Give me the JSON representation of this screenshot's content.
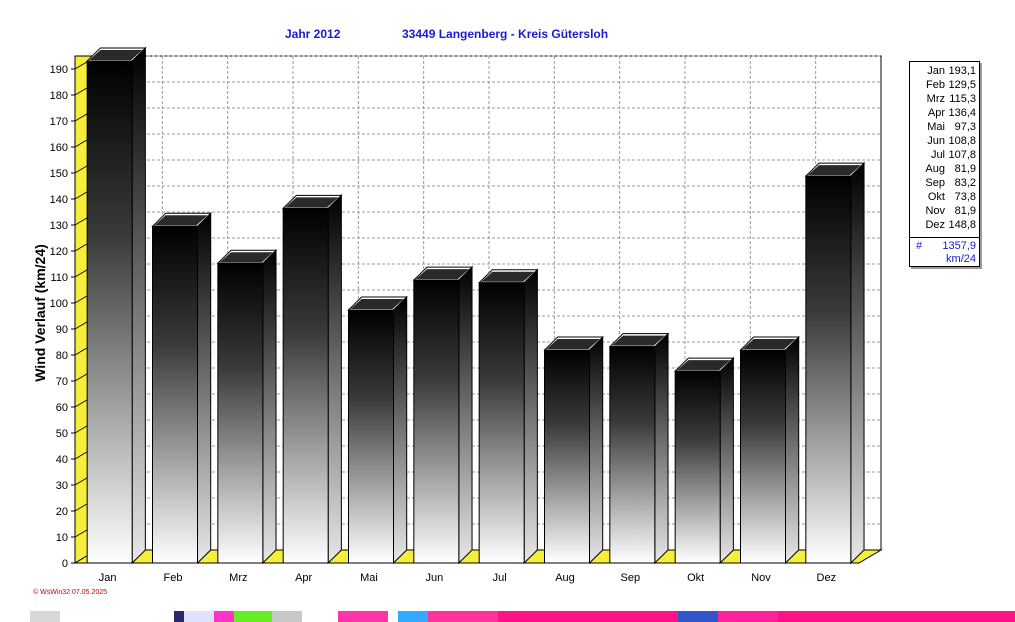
{
  "header": {
    "year_label": "Jahr  2012",
    "station_label": "33449 Langenberg - Kreis Gütersloh"
  },
  "chart_data": {
    "type": "bar",
    "title": "Jahr 2012 · 33449 Langenberg - Kreis Gütersloh",
    "ylabel": "Wind Verlauf  (km/24)",
    "xlabel": "",
    "ylim": [
      0,
      195
    ],
    "yticks": [
      0,
      10,
      20,
      30,
      40,
      50,
      60,
      70,
      80,
      90,
      100,
      110,
      120,
      130,
      140,
      150,
      160,
      170,
      180,
      190
    ],
    "grid": true,
    "categories": [
      "Jan",
      "Feb",
      "Mrz",
      "Apr",
      "Mai",
      "Jun",
      "Jul",
      "Aug",
      "Sep",
      "Okt",
      "Nov",
      "Dez"
    ],
    "values": [
      193.1,
      129.5,
      115.3,
      136.4,
      97.3,
      108.8,
      107.8,
      81.9,
      83.2,
      73.8,
      81.9,
      148.8
    ],
    "legend_placement": "right"
  },
  "legend": {
    "rows": [
      {
        "month": "Jan",
        "value": "193,1"
      },
      {
        "month": "Feb",
        "value": "129,5"
      },
      {
        "month": "Mrz",
        "value": "115,3"
      },
      {
        "month": "Apr",
        "value": "136,4"
      },
      {
        "month": "Mai",
        "value": "97,3"
      },
      {
        "month": "Jun",
        "value": "108,8"
      },
      {
        "month": "Jul",
        "value": "107,8"
      },
      {
        "month": "Aug",
        "value": "81,9"
      },
      {
        "month": "Sep",
        "value": "83,2"
      },
      {
        "month": "Okt",
        "value": "73,8"
      },
      {
        "month": "Nov",
        "value": "81,9"
      },
      {
        "month": "Dez",
        "value": "148,8"
      }
    ],
    "total_symbol": "#",
    "total_value": "1357,9",
    "total_unit": "km/24"
  },
  "footer": {
    "text": "© WsWin32  07.05.2025"
  },
  "colors": {
    "title": "#1a1ad0",
    "floor": "#f5ef3c",
    "grid": "#9a9a9a",
    "footer": "#cc0000"
  }
}
